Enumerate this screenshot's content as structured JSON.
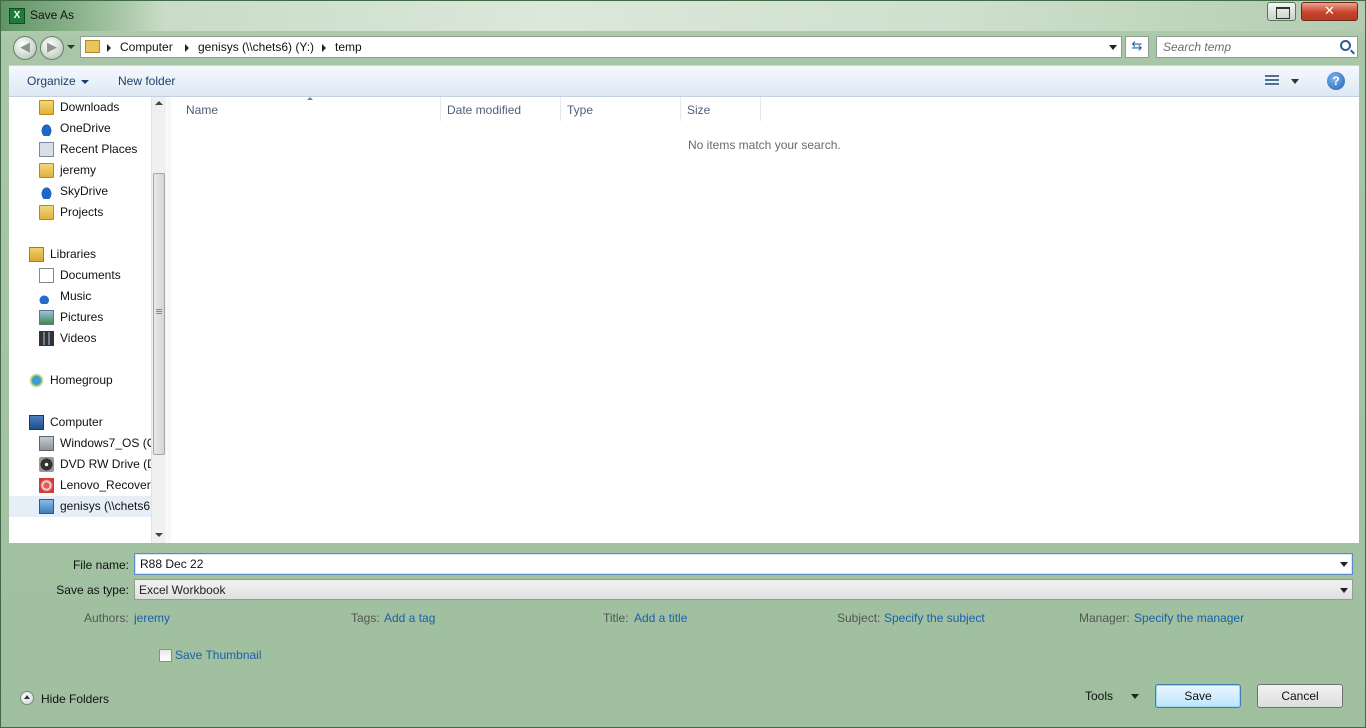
{
  "window": {
    "title": "Save As",
    "app_icon_letter": "X"
  },
  "address": {
    "crumbs": [
      "Computer",
      "genisys (\\\\chets6) (Y:)",
      "temp"
    ]
  },
  "search": {
    "placeholder": "Search temp"
  },
  "toolbar": {
    "organize_label": "Organize",
    "new_folder_label": "New folder",
    "help_label": "?"
  },
  "nav": {
    "items": [
      {
        "label": "Downloads",
        "icon": "downloads-folder-icon"
      },
      {
        "label": "OneDrive",
        "icon": "onedrive-cloud-icon"
      },
      {
        "label": "Recent Places",
        "icon": "recent-places-icon"
      },
      {
        "label": "jeremy",
        "icon": "user-folder-icon"
      },
      {
        "label": "SkyDrive",
        "icon": "skydrive-cloud-icon"
      },
      {
        "label": "Projects",
        "icon": "folder-icon"
      },
      {
        "label": "Libraries",
        "icon": "libraries-icon"
      },
      {
        "label": "Documents",
        "icon": "documents-icon"
      },
      {
        "label": "Music",
        "icon": "music-icon"
      },
      {
        "label": "Pictures",
        "icon": "pictures-icon"
      },
      {
        "label": "Videos",
        "icon": "videos-icon"
      },
      {
        "label": "Homegroup",
        "icon": "homegroup-icon"
      },
      {
        "label": "Computer",
        "icon": "computer-icon"
      },
      {
        "label": "Windows7_OS (C",
        "icon": "drive-icon"
      },
      {
        "label": "DVD RW Drive (D",
        "icon": "dvd-drive-icon"
      },
      {
        "label": "Lenovo_Recovery",
        "icon": "recovery-drive-icon"
      },
      {
        "label": "genisys (\\\\chets6",
        "icon": "network-drive-icon"
      }
    ]
  },
  "file_list": {
    "columns": [
      "Name",
      "Date modified",
      "Type",
      "Size"
    ],
    "empty_message": "No items match your search."
  },
  "form": {
    "file_name_label": "File name:",
    "file_name_value": "R88 Dec 22",
    "save_type_label": "Save as type:",
    "save_type_value": "Excel Workbook",
    "authors_label": "Authors:",
    "authors_value": "jeremy",
    "tags_label": "Tags:",
    "tags_value": "Add a tag",
    "title_label": "Title:",
    "title_value": "Add a title",
    "subject_label": "Subject:",
    "subject_value": "Specify the subject",
    "manager_label": "Manager:",
    "manager_value": "Specify the manager",
    "thumbnail_label": "Save Thumbnail"
  },
  "footer": {
    "hide_folders_label": "Hide Folders",
    "tools_label": "Tools",
    "save_label": "Save",
    "cancel_label": "Cancel"
  }
}
